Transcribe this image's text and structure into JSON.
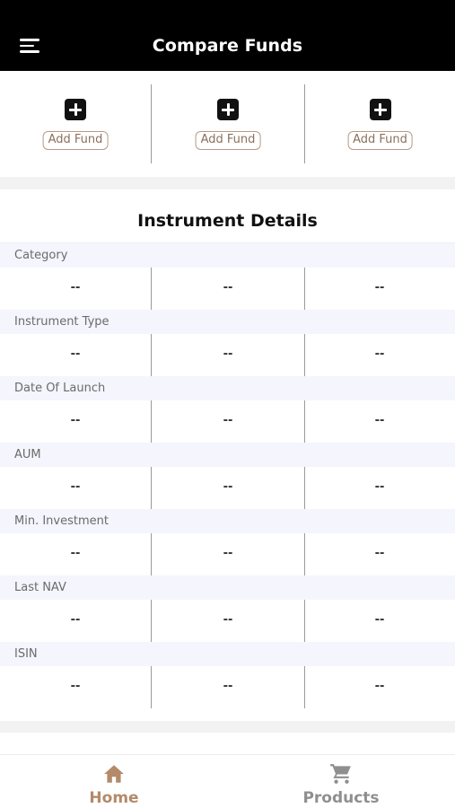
{
  "header": {
    "title": "Compare Funds",
    "menu_icon": "hamburger-menu-icon"
  },
  "fund_slots": [
    {
      "add_label": "Add Fund",
      "icon": "plus-square-icon"
    },
    {
      "add_label": "Add Fund",
      "icon": "plus-square-icon"
    },
    {
      "add_label": "Add Fund",
      "icon": "plus-square-icon"
    }
  ],
  "details": {
    "title": "Instrument Details",
    "rows": [
      {
        "label": "Category",
        "values": [
          "--",
          "--",
          "--"
        ]
      },
      {
        "label": "Instrument Type",
        "values": [
          "--",
          "--",
          "--"
        ]
      },
      {
        "label": "Date Of Launch",
        "values": [
          "--",
          "--",
          "--"
        ]
      },
      {
        "label": "AUM",
        "values": [
          "--",
          "--",
          "--"
        ]
      },
      {
        "label": "Min. Investment",
        "values": [
          "--",
          "--",
          "--"
        ]
      },
      {
        "label": "Last NAV",
        "values": [
          "--",
          "--",
          "--"
        ]
      },
      {
        "label": "ISIN",
        "values": [
          "--",
          "--",
          "--"
        ]
      }
    ]
  },
  "bottom_nav": {
    "home": {
      "label": "Home",
      "icon": "home-icon",
      "active": true
    },
    "products": {
      "label": "Products",
      "icon": "cart-icon",
      "active": false
    }
  },
  "colors": {
    "header_bg": "#000000",
    "accent": "#b48a6a",
    "label_row_bg": "#f4f5fd",
    "inactive": "#8f8f8f"
  }
}
